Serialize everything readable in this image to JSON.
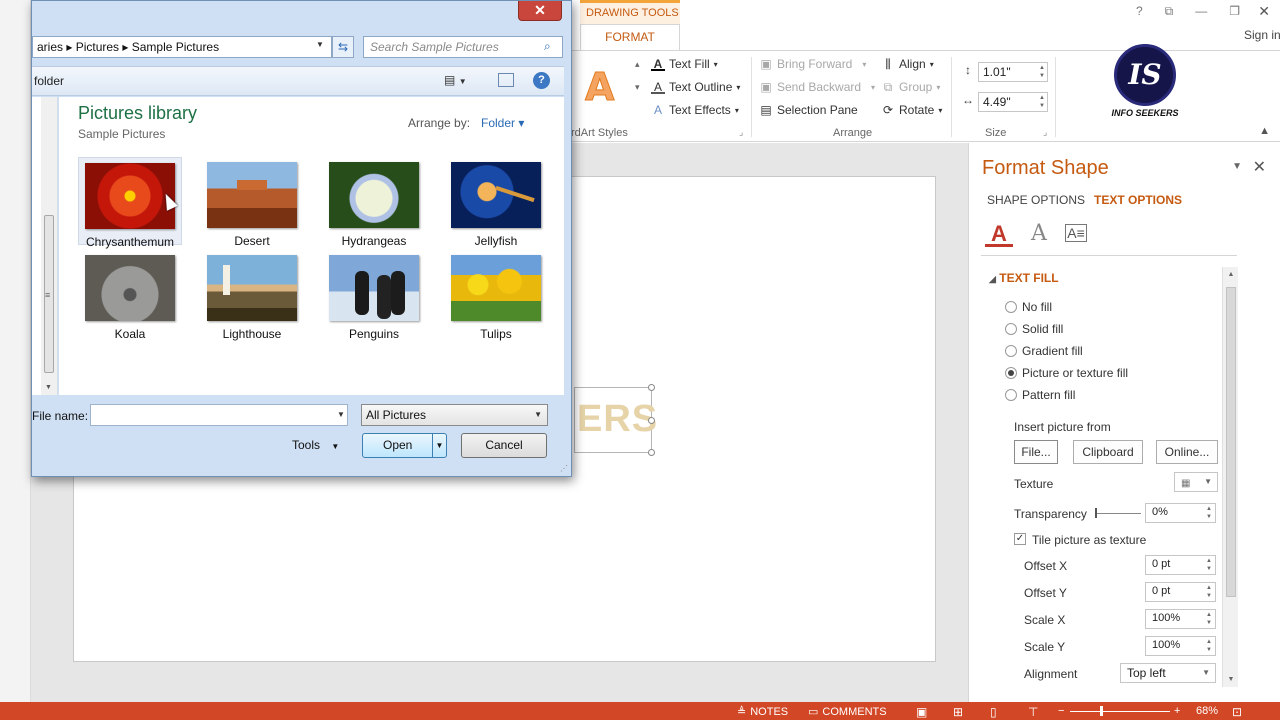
{
  "powerpoint": {
    "contextual_group": "DRAWING TOOLS",
    "active_tab": "FORMAT",
    "window_controls": [
      "?",
      "⧉",
      "—",
      "❐"
    ],
    "close_glyph": "✕",
    "sign_in": "Sign in",
    "ribbon": {
      "text_fill": "Text Fill",
      "text_outline": "Text Outline",
      "text_effects": "Text Effects",
      "wordart_group": "rdArt Styles",
      "bring_forward": "Bring Forward",
      "send_backward": "Send Backward",
      "selection_pane": "Selection Pane",
      "align": "Align",
      "group": "Group",
      "rotate": "Rotate",
      "arrange_group": "Arrange",
      "height": "1.01\"",
      "width": "4.49\"",
      "size_group": "Size",
      "wordart_preview": "A"
    },
    "logo": {
      "initials": "IS",
      "text": "INFO SEEKERS"
    },
    "slide": {
      "visible_text": "ERS"
    },
    "format_pane": {
      "title": "Format Shape",
      "tab_shape": "SHAPE OPTIONS",
      "tab_text": "TEXT OPTIONS",
      "section": "TEXT FILL",
      "fill_options": [
        {
          "label": "No fill",
          "checked": false
        },
        {
          "label": "Solid fill",
          "checked": false
        },
        {
          "label": "Gradient fill",
          "checked": false
        },
        {
          "label": "Picture or texture fill",
          "checked": true
        },
        {
          "label": "Pattern fill",
          "checked": false
        }
      ],
      "insert_from": "Insert picture from",
      "file_btn": "File...",
      "clipboard_btn": "Clipboard",
      "online_btn": "Online...",
      "texture_label": "Texture",
      "transparency_label": "Transparency",
      "transparency_value": "0%",
      "tile_label": "Tile picture as texture",
      "tile_checked": true,
      "offset_x_label": "Offset X",
      "offset_x": "0 pt",
      "offset_y_label": "Offset Y",
      "offset_y": "0 pt",
      "scale_x_label": "Scale X",
      "scale_x": "100%",
      "scale_y_label": "Scale Y",
      "scale_y": "100%",
      "alignment_label": "Alignment",
      "alignment": "Top left"
    },
    "status_bar": {
      "notes": "NOTES",
      "comments": "COMMENTS",
      "zoom_minus": "−",
      "zoom_plus": "+",
      "zoom": "68%"
    }
  },
  "dialog": {
    "close_glyph": "✕",
    "breadcrumb": "aries  ▸  Pictures  ▸  Sample Pictures",
    "search_placeholder": "Search Sample Pictures",
    "new_folder": "folder",
    "library_title": "Pictures library",
    "library_sub": "Sample Pictures",
    "arrange_label": "Arrange by:",
    "arrange_value": "Folder ▾",
    "pictures": [
      "Chrysanthemum",
      "Desert",
      "Hydrangeas",
      "Jellyfish",
      "Koala",
      "Lighthouse",
      "Penguins",
      "Tulips"
    ],
    "file_name_label": "File name:",
    "file_name_value": "",
    "file_type": "All Pictures",
    "tools": "Tools",
    "open": "Open",
    "cancel": "Cancel"
  },
  "colors": {
    "accent": "#c55a11",
    "status_bar": "#d24726",
    "library_title": "#1e7145",
    "link_blue": "#2a6ab5"
  }
}
